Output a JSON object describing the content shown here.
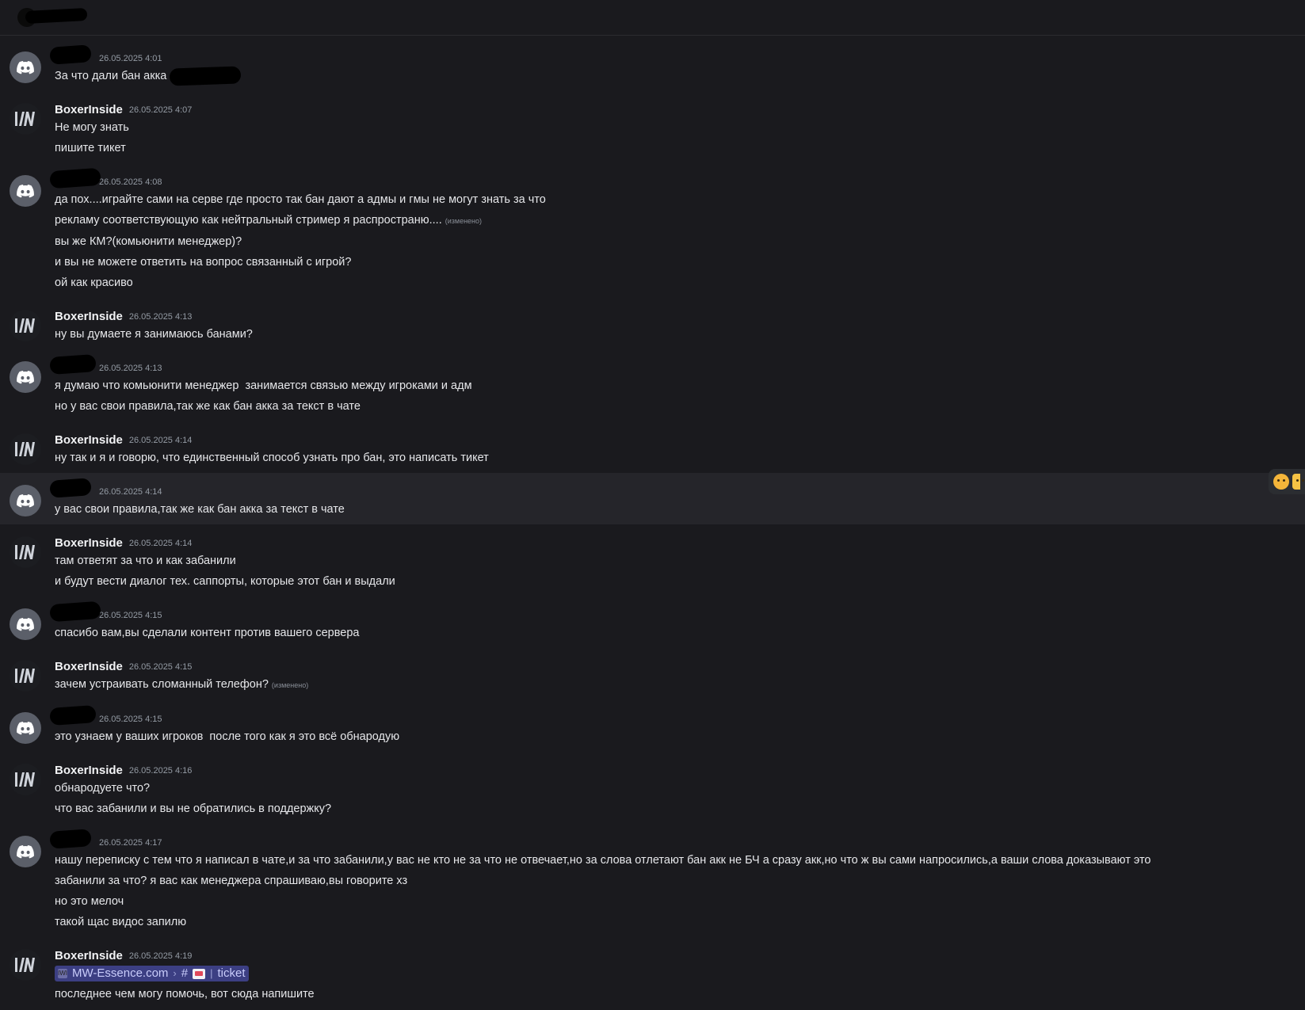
{
  "channel": {
    "title_redacted": true
  },
  "messages": [
    {
      "author": "",
      "avatar": "discord",
      "timestamp": "26.05.2025 4:01",
      "lines": [
        {
          "text": "За что дали бан акка",
          "inline_redact": true
        }
      ]
    },
    {
      "author": "BoxerInside",
      "avatar": "boxer",
      "timestamp": "26.05.2025 4:07",
      "lines": [
        {
          "text": "Не могу знать"
        },
        {
          "text": "пишите тикет"
        }
      ]
    },
    {
      "author": "",
      "avatar": "discord",
      "timestamp": "26.05.2025 4:08",
      "lines": [
        {
          "text": "да пох....играйте сами на серве где просто так бан дают а адмы и гмы не могут знать за что"
        },
        {
          "text": "рекламу соответствующую как нейтральный стример я распространю....",
          "edited": "(изменено)"
        },
        {
          "text": "вы же КМ?(комьюнити менеджер)?"
        },
        {
          "text": "и вы не можете ответить на вопрос связанный с игрой?"
        },
        {
          "text": "ой как красиво"
        }
      ]
    },
    {
      "author": "BoxerInside",
      "avatar": "boxer",
      "timestamp": "26.05.2025 4:13",
      "lines": [
        {
          "text": "ну вы думаете я занимаюсь банами?"
        }
      ]
    },
    {
      "author": "",
      "avatar": "discord",
      "timestamp": "26.05.2025 4:13",
      "lines": [
        {
          "text": "я думаю что комьюнити менеджер  занимается связью между игроками и адм"
        },
        {
          "text": "но у вас свои правила,так же как бан акка за текст в чате"
        }
      ]
    },
    {
      "author": "BoxerInside",
      "avatar": "boxer",
      "timestamp": "26.05.2025 4:14",
      "lines": [
        {
          "text": "ну так и я и говорю, что единственный способ узнать про бан, это написать тикет"
        }
      ]
    },
    {
      "author": "",
      "avatar": "discord",
      "timestamp": "26.05.2025 4:14",
      "highlight": true,
      "lines": [
        {
          "text": "у вас свои правила,так же как бан акка за текст в чате"
        }
      ]
    },
    {
      "author": "BoxerInside",
      "avatar": "boxer",
      "timestamp": "26.05.2025 4:14",
      "lines": [
        {
          "text": "там ответят за что и как забанили"
        },
        {
          "text": "и будут вести диалог тех. саппорты, которые этот бан и выдали"
        }
      ]
    },
    {
      "author": "",
      "avatar": "discord",
      "timestamp": "26.05.2025 4:15",
      "lines": [
        {
          "text": "спасибо вам,вы сделали контент против вашего сервера"
        }
      ]
    },
    {
      "author": "BoxerInside",
      "avatar": "boxer",
      "timestamp": "26.05.2025 4:15",
      "lines": [
        {
          "text": "зачем устраивать сломанный телефон?",
          "edited": "(изменено)"
        }
      ]
    },
    {
      "author": "",
      "avatar": "discord",
      "timestamp": "26.05.2025 4:15",
      "lines": [
        {
          "text": "это узнаем у ваших игроков  после того как я это всё обнародую"
        }
      ]
    },
    {
      "author": "BoxerInside",
      "avatar": "boxer",
      "timestamp": "26.05.2025 4:16",
      "lines": [
        {
          "text": "обнародуете что?"
        },
        {
          "text": "что вас забанили и вы не обратились в поддержку?"
        }
      ]
    },
    {
      "author": "",
      "avatar": "discord",
      "timestamp": "26.05.2025 4:17",
      "lines": [
        {
          "text": "нашу переписку с тем что я написал в чате,и за что забанили,у вас не кто не за что не отвечает,но за слова отлетают бан акк не БЧ а сразу акк,но что ж вы сами напросились,а ваши слова доказывают это"
        },
        {
          "text": "забанили за что? я вас как менеджера спрашиваю,вы говорите хз"
        },
        {
          "text": "но это мелоч"
        },
        {
          "text": "такой щас видос запилю"
        }
      ]
    },
    {
      "author": "BoxerInside",
      "avatar": "boxer",
      "timestamp": "26.05.2025 4:19",
      "lines": [
        {
          "mention": true,
          "server": "MW-Essence.com",
          "channel": "ticket"
        },
        {
          "text": "последнее чем могу помочь, вот сюда напишите"
        }
      ]
    }
  ]
}
